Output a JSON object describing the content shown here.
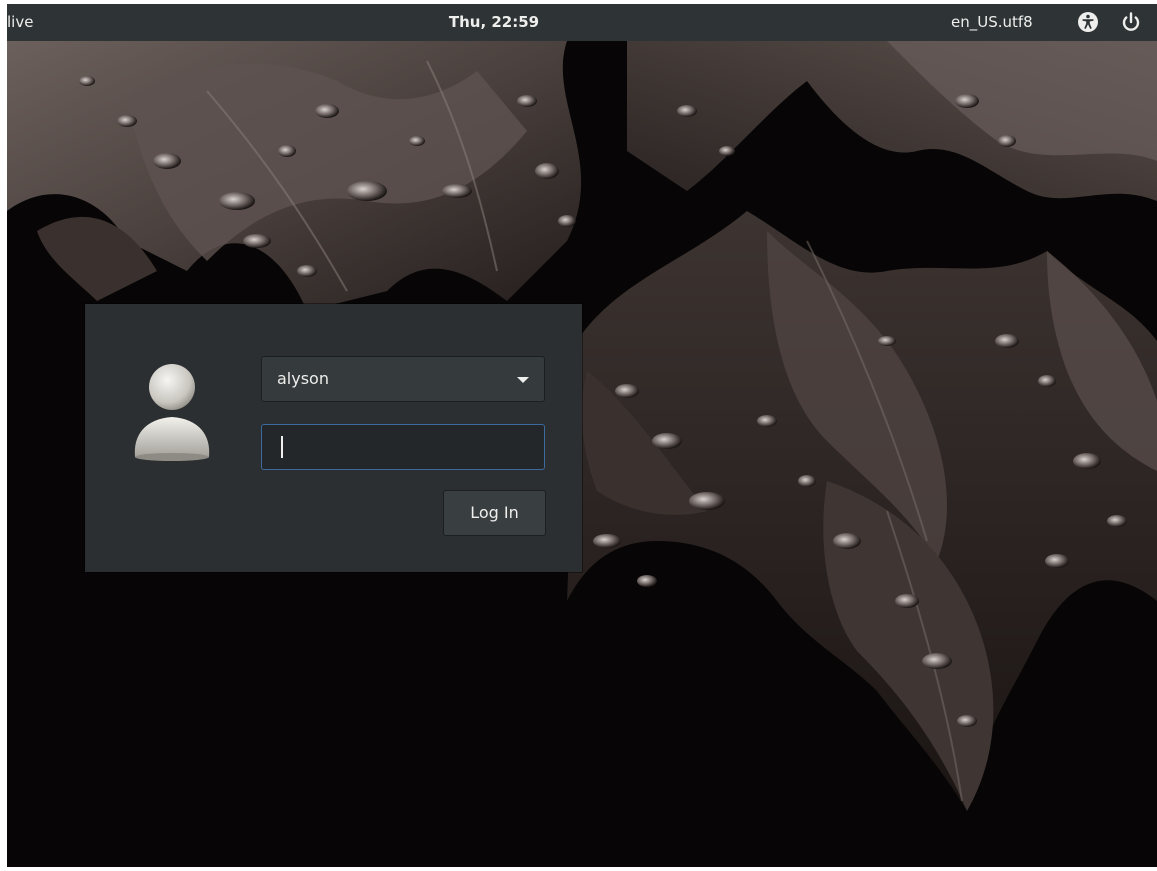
{
  "top_bar": {
    "host": "live",
    "clock": "Thu, 22:59",
    "locale": "en_US.utf8",
    "accessibility_icon": "accessibility-icon",
    "power_icon": "power-icon",
    "background_color": "#2e3436"
  },
  "login": {
    "user_select": {
      "value": "alyson",
      "options": [
        "alyson"
      ]
    },
    "password": {
      "value": "",
      "focused": true
    },
    "login_button_label": "Log In",
    "avatar_icon": "user-avatar-icon",
    "panel_color": "#2b2f31",
    "focus_color": "#3d6a9e"
  },
  "wallpaper": {
    "description": "dark leaves with water droplets"
  }
}
